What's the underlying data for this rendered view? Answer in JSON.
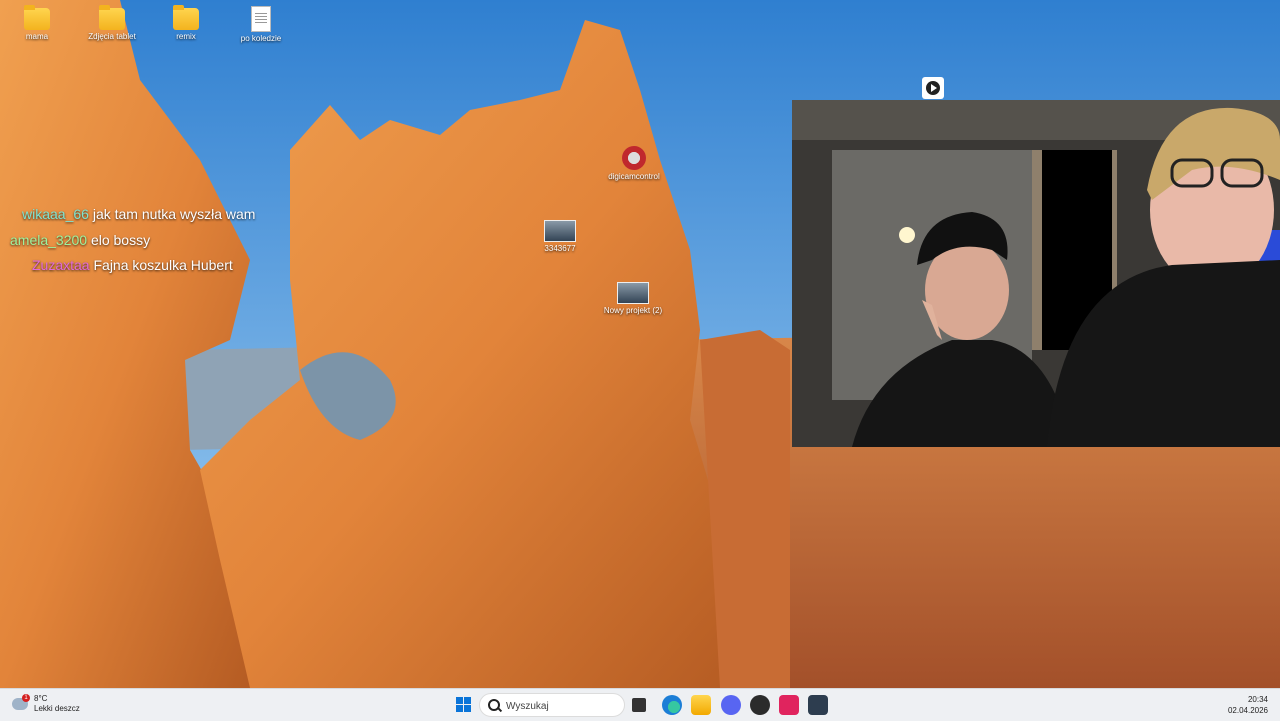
{
  "desktop": {
    "icons": [
      {
        "label": "mama",
        "icon": "folder-photo-icon"
      },
      {
        "label": "Zdjęcia tablet",
        "icon": "folder-icon"
      },
      {
        "label": "remix",
        "icon": "folder-icon"
      },
      {
        "label": "po koledzie",
        "icon": "document-icon"
      },
      {
        "label": "digicamcontrol",
        "icon": "app-shortcut-icon"
      },
      {
        "label": "3343677",
        "icon": "image-thumbnail-icon"
      },
      {
        "label": "Nowy projekt (2)",
        "icon": "image-thumbnail-icon"
      }
    ]
  },
  "chat": {
    "messages": [
      {
        "user": "wikaaa_66",
        "text": "jak tam nutka wyszła wam",
        "user_color": "#7fe3d0"
      },
      {
        "user": "amela_3200",
        "text": "elo bossy",
        "user_color": "#9ef29e"
      },
      {
        "user": "Zuzaxtaa",
        "text": "Fajna koszulka Hubert",
        "user_color": "#e06ad8"
      }
    ]
  },
  "webcam": {
    "icon": "play-circle-icon"
  },
  "taskbar": {
    "weather": {
      "temp": "8°C",
      "desc": "Lekki deszcz",
      "badge": "1"
    },
    "search": {
      "placeholder": "Wyszukaj"
    },
    "clock": {
      "time": "20:34",
      "date": "02.04.2026"
    },
    "apps": [
      "windows-start-icon",
      "task-view-icon",
      "edge-icon",
      "file-explorer-icon",
      "discord-icon",
      "obs-icon",
      "tiktok-icon",
      "digicamcontrol-icon"
    ]
  }
}
